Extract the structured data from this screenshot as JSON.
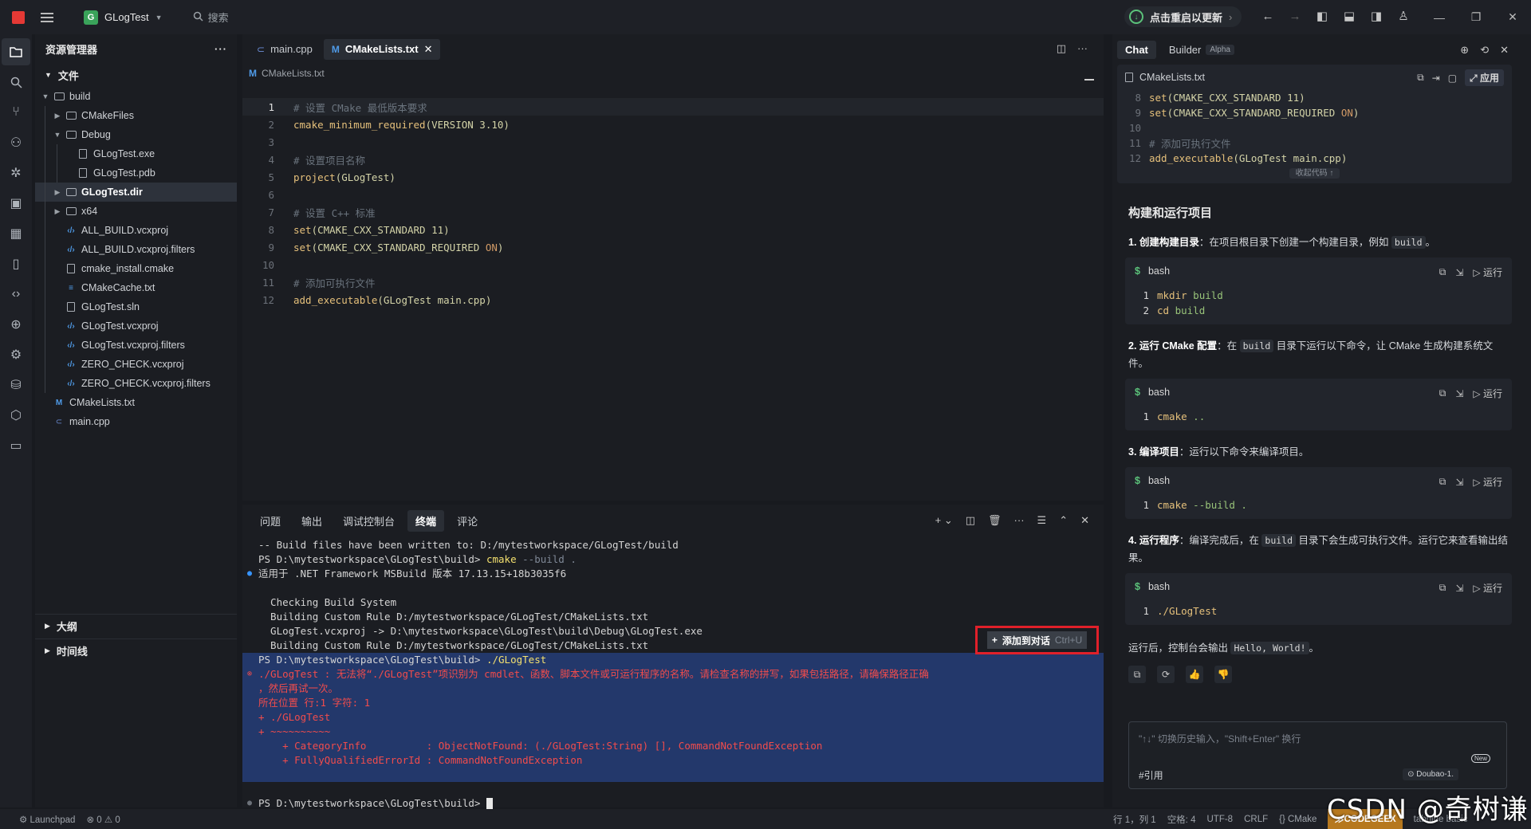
{
  "titlebar": {
    "project": "GLogTest",
    "project_initial": "G",
    "search_placeholder": "搜索",
    "update_label": "点击重启以更新"
  },
  "explorer": {
    "title": "资源管理器",
    "section_files": "文件",
    "outline": "大纲",
    "timeline": "时间线",
    "items": [
      {
        "label": "build",
        "depth": 0,
        "type": "folder",
        "open": true
      },
      {
        "label": "CMakeFiles",
        "depth": 1,
        "type": "folder",
        "open": false
      },
      {
        "label": "Debug",
        "depth": 1,
        "type": "folder",
        "open": true
      },
      {
        "label": "GLogTest.exe",
        "depth": 2,
        "type": "file"
      },
      {
        "label": "GLogTest.pdb",
        "depth": 2,
        "type": "file"
      },
      {
        "label": "GLogTest.dir",
        "depth": 1,
        "type": "folder",
        "open": false,
        "selected": true
      },
      {
        "label": "x64",
        "depth": 1,
        "type": "folder",
        "open": false
      },
      {
        "label": "ALL_BUILD.vcxproj",
        "depth": 1,
        "type": "xml"
      },
      {
        "label": "ALL_BUILD.vcxproj.filters",
        "depth": 1,
        "type": "xml"
      },
      {
        "label": "cmake_install.cmake",
        "depth": 1,
        "type": "file"
      },
      {
        "label": "CMakeCache.txt",
        "depth": 1,
        "type": "eq"
      },
      {
        "label": "GLogTest.sln",
        "depth": 1,
        "type": "file"
      },
      {
        "label": "GLogTest.vcxproj",
        "depth": 1,
        "type": "xml"
      },
      {
        "label": "GLogTest.vcxproj.filters",
        "depth": 1,
        "type": "xml"
      },
      {
        "label": "ZERO_CHECK.vcxproj",
        "depth": 1,
        "type": "xml"
      },
      {
        "label": "ZERO_CHECK.vcxproj.filters",
        "depth": 1,
        "type": "xml"
      },
      {
        "label": "CMakeLists.txt",
        "depth": 0,
        "type": "cmake"
      },
      {
        "label": "main.cpp",
        "depth": 0,
        "type": "cpp"
      }
    ]
  },
  "editor": {
    "tabs": [
      {
        "label": "main.cpp",
        "active": false
      },
      {
        "label": "CMakeLists.txt",
        "active": true
      }
    ],
    "breadcrumb": "CMakeLists.txt",
    "lines": [
      {
        "n": "1",
        "parts": [
          [
            "c-com",
            "# 设置 CMake 最低版本要求"
          ]
        ]
      },
      {
        "n": "2",
        "parts": [
          [
            "c-fn",
            "cmake_minimum_required"
          ],
          [
            "c-arg",
            "(VERSION 3.10)"
          ]
        ]
      },
      {
        "n": "3",
        "parts": []
      },
      {
        "n": "4",
        "parts": [
          [
            "c-com",
            "# 设置项目名称"
          ]
        ]
      },
      {
        "n": "5",
        "parts": [
          [
            "c-fn",
            "project"
          ],
          [
            "c-arg",
            "(GLogTest)"
          ]
        ]
      },
      {
        "n": "6",
        "parts": []
      },
      {
        "n": "7",
        "parts": [
          [
            "c-com",
            "# 设置 C++ 标准"
          ]
        ]
      },
      {
        "n": "8",
        "parts": [
          [
            "c-fn",
            "set"
          ],
          [
            "c-arg",
            "(CMAKE_CXX_STANDARD 11)"
          ]
        ]
      },
      {
        "n": "9",
        "parts": [
          [
            "c-fn",
            "set"
          ],
          [
            "c-arg",
            "(CMAKE_CXX_STANDARD_REQUIRED "
          ],
          [
            "c-on",
            "ON"
          ],
          [
            "c-arg",
            ")"
          ]
        ]
      },
      {
        "n": "10",
        "parts": []
      },
      {
        "n": "11",
        "parts": [
          [
            "c-com",
            "# 添加可执行文件"
          ]
        ]
      },
      {
        "n": "12",
        "parts": [
          [
            "c-fn",
            "add_executable"
          ],
          [
            "c-arg",
            "(GLogTest main.cpp)"
          ]
        ]
      }
    ]
  },
  "panel": {
    "tabs": [
      "问题",
      "输出",
      "调试控制台",
      "终端",
      "评论"
    ],
    "active_tab": "终端",
    "add_to_chat": "添加到对话",
    "add_to_chat_shortcut": "Ctrl+U",
    "terminal": [
      {
        "hl": false,
        "dot": "",
        "parts": [
          [
            "",
            "-- Build files have been written to: D:/mytestworkspace/GLogTest/build"
          ]
        ]
      },
      {
        "hl": false,
        "dot": "",
        "parts": [
          [
            "",
            "PS D:\\mytestworkspace\\GLogTest\\build> "
          ],
          [
            "t-cmd",
            "cmake"
          ],
          [
            "t-arg",
            " --build ."
          ]
        ]
      },
      {
        "hl": false,
        "dot": "blue",
        "parts": [
          [
            "",
            "适用于 .NET Framework MSBuild 版本 17.13.15+18b3035f6"
          ]
        ]
      },
      {
        "hl": false,
        "dot": "",
        "parts": [
          [
            "",
            ""
          ]
        ]
      },
      {
        "hl": false,
        "dot": "",
        "parts": [
          [
            "",
            "  Checking Build System"
          ]
        ]
      },
      {
        "hl": false,
        "dot": "",
        "parts": [
          [
            "",
            "  Building Custom Rule D:/mytestworkspace/GLogTest/CMakeLists.txt"
          ]
        ]
      },
      {
        "hl": false,
        "dot": "",
        "parts": [
          [
            "",
            "  GLogTest.vcxproj -> D:\\mytestworkspace\\GLogTest\\build\\Debug\\GLogTest.exe"
          ]
        ]
      },
      {
        "hl": false,
        "dot": "",
        "parts": [
          [
            "",
            "  Building Custom Rule D:/mytestworkspace/GLogTest/CMakeLists.txt"
          ]
        ]
      },
      {
        "hl": true,
        "dot": "",
        "parts": [
          [
            "",
            "PS D:\\mytestworkspace\\GLogTest\\build> "
          ],
          [
            "t-cmd",
            "./GLogTest"
          ]
        ]
      },
      {
        "hl": true,
        "dot": "red",
        "parts": [
          [
            "t-err",
            "./GLogTest : 无法将“./GLogTest”项识别为 cmdlet、函数、脚本文件或可运行程序的名称。请检查名称的拼写，如果包括路径，请确保路径正确"
          ]
        ]
      },
      {
        "hl": true,
        "dot": "",
        "parts": [
          [
            "t-err",
            "，然后再试一次。"
          ]
        ]
      },
      {
        "hl": true,
        "dot": "",
        "parts": [
          [
            "t-err",
            "所在位置 行:1 字符: 1"
          ]
        ]
      },
      {
        "hl": true,
        "dot": "",
        "parts": [
          [
            "t-err",
            "+ ./GLogTest"
          ]
        ]
      },
      {
        "hl": true,
        "dot": "",
        "parts": [
          [
            "t-err",
            "+ ~~~~~~~~~~"
          ]
        ]
      },
      {
        "hl": true,
        "dot": "",
        "parts": [
          [
            "t-err",
            "    + CategoryInfo          : ObjectNotFound: (./GLogTest:String) [], CommandNotFoundException"
          ]
        ]
      },
      {
        "hl": true,
        "dot": "",
        "parts": [
          [
            "t-err",
            "    + FullyQualifiedErrorId : CommandNotFoundException"
          ]
        ]
      },
      {
        "hl": true,
        "dot": "",
        "parts": [
          [
            "",
            ""
          ]
        ]
      },
      {
        "hl": false,
        "dot": "",
        "parts": [
          [
            "",
            ""
          ]
        ]
      },
      {
        "hl": false,
        "dot": "grey",
        "parts": [
          [
            "",
            "PS D:\\mytestworkspace\\GLogTest\\build> "
          ]
        ]
      }
    ]
  },
  "chat": {
    "tab_chat": "Chat",
    "tab_builder": "Builder",
    "builder_badge": "Alpha",
    "card_file": "CMakeLists.txt",
    "apply_label": "应用",
    "collapse_label": "收起代码 ↑",
    "card_lines": [
      {
        "n": "8",
        "parts": [
          [
            "c-fn",
            "set"
          ],
          [
            "c-arg",
            "(CMAKE_CXX_STANDARD 11)"
          ]
        ]
      },
      {
        "n": "9",
        "parts": [
          [
            "c-fn",
            "set"
          ],
          [
            "c-arg",
            "(CMAKE_CXX_STANDARD_REQUIRED "
          ],
          [
            "c-on",
            "ON"
          ],
          [
            "c-arg",
            ")"
          ]
        ]
      },
      {
        "n": "10",
        "parts": []
      },
      {
        "n": "11",
        "parts": [
          [
            "c-com",
            "# 添加可执行文件"
          ]
        ]
      },
      {
        "n": "12",
        "parts": [
          [
            "c-fn",
            "add_executable"
          ],
          [
            "c-arg",
            "(GLogTest main.cpp)"
          ]
        ]
      }
    ],
    "heading": "构建和运行项目",
    "run_label": "运行",
    "bash_label": "bash",
    "steps": [
      {
        "title": "1. 创建构建目录",
        "text": "：在项目根目录下创建一个构建目录，例如 ",
        "code": "build",
        "tail": "。",
        "lines": [
          [
            "mkdir",
            "build"
          ],
          [
            "cd",
            "build"
          ]
        ]
      },
      {
        "title": "2. 运行 CMake 配置",
        "text": "：在 ",
        "code": "build",
        "tail": " 目录下运行以下命令，让 CMake 生成构建系统文件。",
        "lines": [
          [
            "cmake",
            ".."
          ]
        ]
      },
      {
        "title": "3. 编译项目",
        "text": "：运行以下命令来编译项目。",
        "code": "",
        "tail": "",
        "lines": [
          [
            "cmake",
            "--build ."
          ]
        ]
      },
      {
        "title": "4. 运行程序",
        "text": "：编译完成后，在 ",
        "code": "build",
        "tail": " 目录下会生成可执行文件。运行它来查看输出结果。",
        "lines": [
          [
            "./GLogTest",
            ""
          ]
        ]
      }
    ],
    "after_text": "运行后，控制台会输出 ",
    "after_code": "Hello, World!",
    "after_tail": "。",
    "input_placeholder": "\"↑↓\" 切换历史输入，\"Shift+Enter\" 换行",
    "ref_label": "#引用",
    "model_label": "Doubao-1.",
    "new_badge": "New"
  },
  "status": {
    "launchpad": "Launchpad",
    "errors": "0",
    "warnings": "0",
    "position": "行 1，列 1",
    "spaces": "空格: 4",
    "encoding": "UTF-8",
    "eol": "CRLF",
    "language": "CMake",
    "codegeex": "CODEGEEX",
    "tabnine": "tabnine basic"
  },
  "watermark": "CSDN @奇树谦"
}
